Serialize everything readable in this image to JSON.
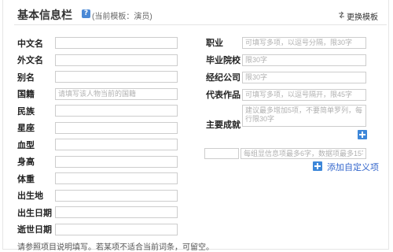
{
  "header": {
    "title": "基本信息栏",
    "template_note": "(当前模板：演员)",
    "change_template_label": "更换模板"
  },
  "left_fields": [
    {
      "label": "中文名",
      "placeholder": ""
    },
    {
      "label": "外文名",
      "placeholder": ""
    },
    {
      "label": "别名",
      "placeholder": ""
    },
    {
      "label": "国籍",
      "placeholder": "请填写该人物当前的国籍"
    },
    {
      "label": "民族",
      "placeholder": ""
    },
    {
      "label": "星座",
      "placeholder": ""
    },
    {
      "label": "血型",
      "placeholder": ""
    },
    {
      "label": "身高",
      "placeholder": ""
    },
    {
      "label": "体重",
      "placeholder": ""
    },
    {
      "label": "出生地",
      "placeholder": ""
    },
    {
      "label": "出生日期",
      "placeholder": ""
    },
    {
      "label": "逝世日期",
      "placeholder": ""
    }
  ],
  "right_fields": [
    {
      "label": "职业",
      "placeholder": "可填写多项，以逗号分隔，限30字"
    },
    {
      "label": "毕业院校",
      "placeholder": "限30字"
    },
    {
      "label": "经纪公司",
      "placeholder": "限30字"
    },
    {
      "label": "代表作品",
      "placeholder": "可填写多项，以逗号隔开，限45字"
    }
  ],
  "achievements": {
    "label": "主要成就",
    "placeholder": "建议最多增加5项，不要简单罗列，每行限30字"
  },
  "custom_item": {
    "name_placeholder": "",
    "value_placeholder": "每组显信息项最多6字，数据项最多15字",
    "add_label": "添加自定义项"
  },
  "footer_note": "请参照项目说明填写。若某项不适合当前词条，可留空。",
  "icons": {
    "help": "help-icon",
    "change_template": "swap-icon",
    "add_achievement": "plus-icon",
    "add_custom": "plus-icon"
  },
  "colors": {
    "accent": "#3d87d9",
    "link": "#3366cc",
    "input_border": "#cdcdcd",
    "placeholder": "#b0b0b0"
  }
}
